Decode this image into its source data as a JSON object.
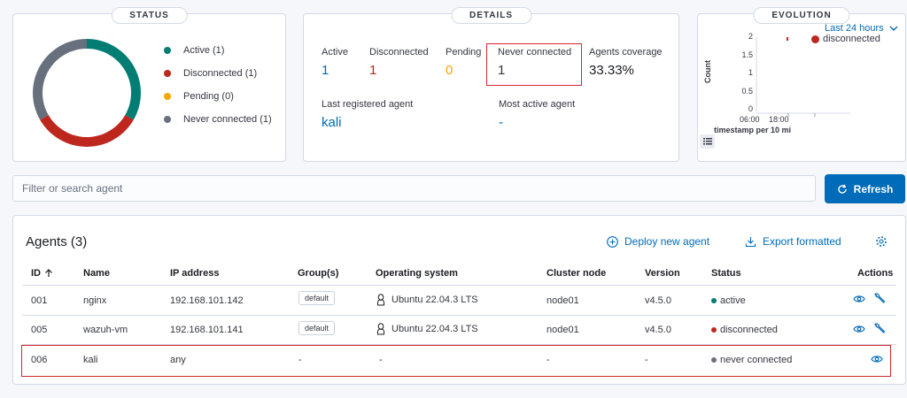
{
  "status": {
    "badge": "STATUS",
    "legend": [
      {
        "label": "Active (1)",
        "color": "#017d73"
      },
      {
        "label": "Disconnected (1)",
        "color": "#bd271e"
      },
      {
        "label": "Pending (0)",
        "color": "#f5a700"
      },
      {
        "label": "Never connected (1)",
        "color": "#69707d"
      }
    ]
  },
  "details": {
    "badge": "DETAILS",
    "active_label": "Active",
    "active_value": "1",
    "disconnected_label": "Disconnected",
    "disconnected_value": "1",
    "pending_label": "Pending",
    "pending_value": "0",
    "never_label": "Never connected",
    "never_value": "1",
    "coverage_label": "Agents coverage",
    "coverage_value": "33.33%",
    "last_registered_label": "Last registered agent",
    "last_registered_value": "kali",
    "most_active_label": "Most active agent",
    "most_active_value": "-"
  },
  "evolution": {
    "badge": "EVOLUTION",
    "range": "Last 24 hours",
    "legend": "disconnected",
    "ylabel": "Count",
    "xlabel": "timestamp per 10 mi",
    "yticks": [
      "2",
      "1.5",
      "1",
      "0.5",
      "0"
    ],
    "xticks": [
      "06:00",
      "18:00"
    ]
  },
  "search": {
    "placeholder": "Filter or search agent"
  },
  "refresh_label": "Refresh",
  "agents": {
    "title": "Agents (3)",
    "deploy_label": "Deploy new agent",
    "export_label": "Export formatted",
    "columns": [
      "ID",
      "Name",
      "IP address",
      "Group(s)",
      "Operating system",
      "Cluster node",
      "Version",
      "Status",
      "Actions"
    ],
    "rows": [
      {
        "id": "001",
        "name": "nginx",
        "ip": "192.168.101.142",
        "group": "default",
        "os": "Ubuntu 22.04.3 LTS",
        "node": "node01",
        "version": "v4.5.0",
        "status": "active",
        "status_color": "#017d73"
      },
      {
        "id": "005",
        "name": "wazuh-vm",
        "ip": "192.168.101.141",
        "group": "default",
        "os": "Ubuntu 22.04.3 LTS",
        "node": "node01",
        "version": "v4.5.0",
        "status": "disconnected",
        "status_color": "#bd271e"
      },
      {
        "id": "006",
        "name": "kali",
        "ip": "any",
        "group": "-",
        "os": "-",
        "node": "-",
        "version": "-",
        "status": "never connected",
        "status_color": "#69707d"
      }
    ]
  }
}
